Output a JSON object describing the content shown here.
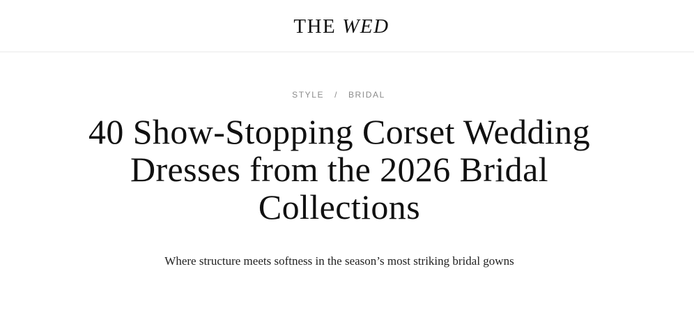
{
  "header": {
    "logo": {
      "first": "THE",
      "second": "WED"
    }
  },
  "breadcrumb": {
    "items": [
      "STYLE",
      "BRIDAL"
    ],
    "separator": "/"
  },
  "article": {
    "title_lines": [
      "40 Show-Stopping Corset Wedding",
      "Dresses from the 2026 Bridal",
      "Collections"
    ],
    "subtitle": "Where structure meets softness in the season’s most striking bridal gowns"
  },
  "colors": {
    "text": "#111111",
    "muted": "#8b8b8b",
    "divider": "#eaeaea",
    "background": "#ffffff"
  }
}
